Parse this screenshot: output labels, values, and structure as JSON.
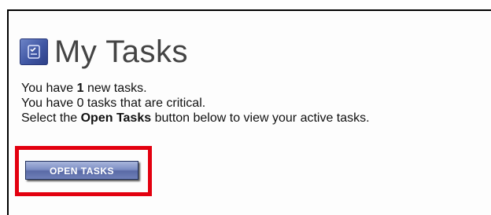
{
  "header": {
    "title": "My Tasks",
    "icon": "tasks-icon"
  },
  "messages": {
    "line1_prefix": "You have ",
    "line1_count": "1",
    "line1_suffix": " new tasks.",
    "line2": "You have 0 tasks that are critical.",
    "line3_prefix": "Select the ",
    "line3_bold": "Open Tasks",
    "line3_suffix": " button below to view your active tasks."
  },
  "actions": {
    "open_tasks_label": "OPEN TASKS"
  },
  "colors": {
    "highlight": "#e3000f",
    "button": "#6f80b9",
    "icon": "#3f56a3"
  }
}
